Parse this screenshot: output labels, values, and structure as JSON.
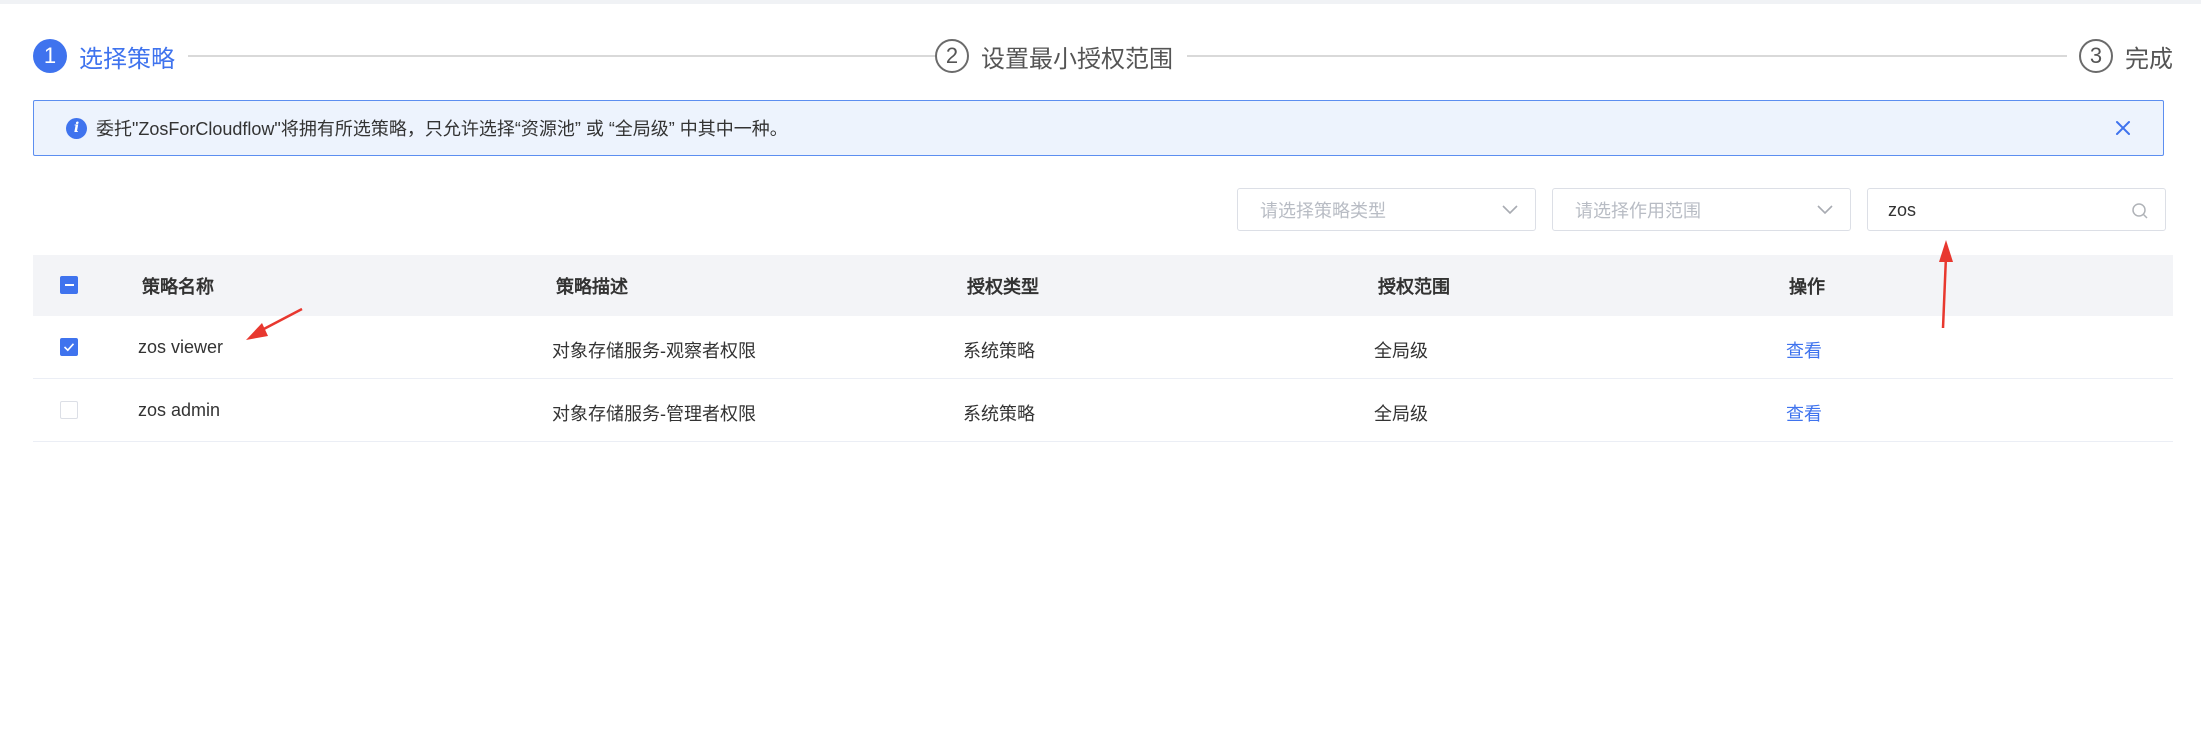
{
  "steps": [
    {
      "number": "1",
      "title": "选择策略",
      "state": "active"
    },
    {
      "number": "2",
      "title": "设置最小授权范围",
      "state": "wait"
    },
    {
      "number": "3",
      "title": "完成",
      "state": "wait"
    }
  ],
  "alert": {
    "icon": "info-icon",
    "text": "委托\"ZosForCloudflow\"将拥有所选策略，只允许选择“资源池” 或 “全局级” 中其中一种。"
  },
  "filters": {
    "policy_type_placeholder": "请选择策略类型",
    "scope_placeholder": "请选择作用范围",
    "search_value": "zos"
  },
  "table": {
    "columns": [
      "策略名称",
      "策略描述",
      "授权类型",
      "授权范围",
      "操作"
    ],
    "select_all_state": "indeterminate",
    "rows": [
      {
        "name": "zos viewer",
        "description": "对象存储服务-观察者权限",
        "type": "系统策略",
        "scope": "全局级",
        "action": "查看",
        "checked": true
      },
      {
        "name": "zos admin",
        "description": "对象存储服务-管理者权限",
        "type": "系统策略",
        "scope": "全局级",
        "action": "查看",
        "checked": false
      }
    ]
  },
  "colors": {
    "primary": "#3f73ee",
    "annotation_arrow": "#e8382f"
  }
}
